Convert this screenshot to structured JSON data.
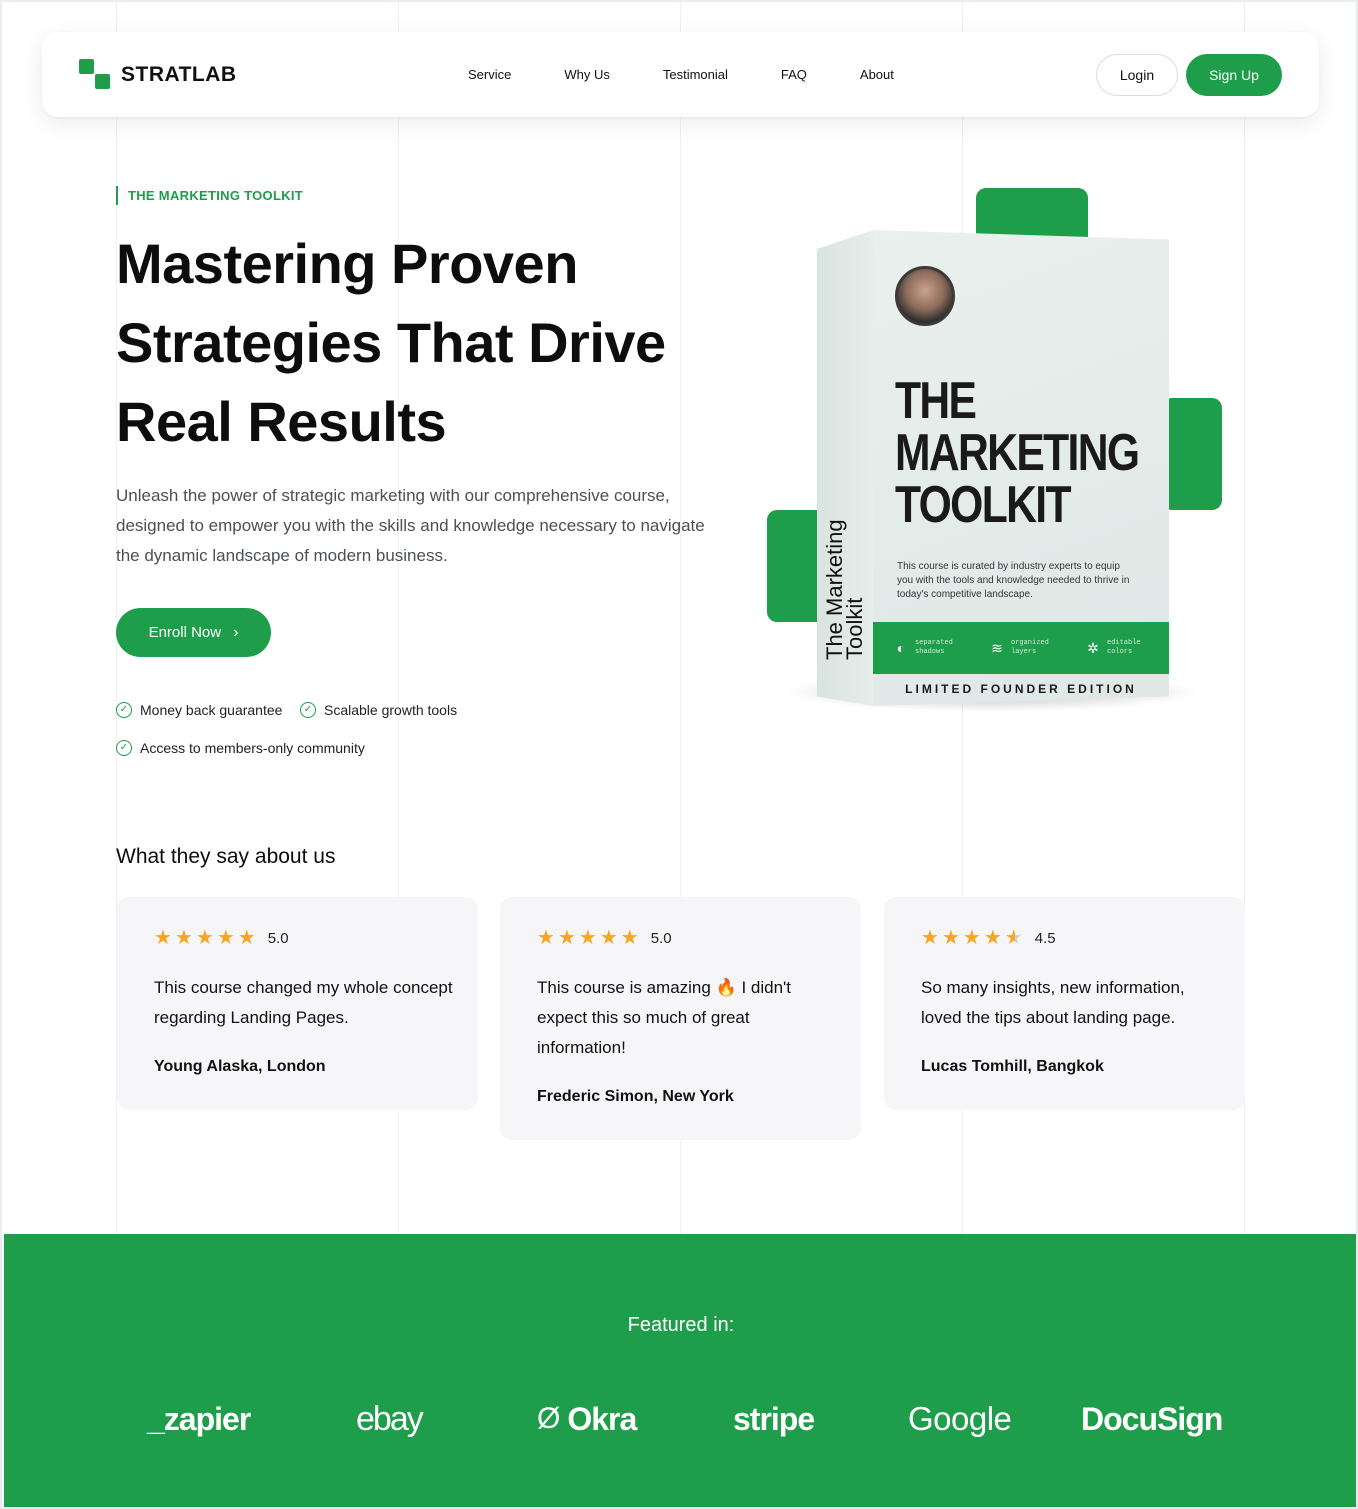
{
  "brand": {
    "name": "STRATLAB",
    "accent": "#1e9e4a"
  },
  "nav": {
    "links": [
      "Service",
      "Why Us",
      "Testimonial",
      "FAQ",
      "About"
    ],
    "login": "Login",
    "signup": "Sign Up"
  },
  "hero": {
    "eyebrow": "THE MARKETING TOOLKIT",
    "title": "Mastering Proven Strategies That Drive Real Results",
    "description": "Unleash the power of strategic marketing with our comprehensive course, designed to empower you with the skills and knowledge necessary to navigate the dynamic landscape of modern business.",
    "cta": "Enroll Now",
    "features": [
      "Money back guarantee",
      "Scalable growth tools",
      "Access to members-only  community"
    ]
  },
  "product": {
    "spine": "The Marketing Toolkit",
    "title": "THE MARKETING TOOLKIT",
    "blurb": "This course is curated by industry experts to equip you with the tools and knowledge needed to thrive in today's competitive landscape.",
    "band": [
      {
        "icon": "leaf-icon",
        "label": "separated shadows"
      },
      {
        "icon": "layers-icon",
        "label": "organized layers"
      },
      {
        "icon": "palette-icon",
        "label": "editable colors"
      }
    ],
    "edition": "LIMITED FOUNDER EDITION"
  },
  "testimonials": {
    "title": "What they say about us",
    "items": [
      {
        "rating": "5.0",
        "stars": 5,
        "quote": "This course changed my whole concept regarding Landing Pages.",
        "author": "Young Alaska, London"
      },
      {
        "rating": "5.0",
        "stars": 5,
        "quote": "This course is amazing 🔥 I didn't expect this so much of great information!",
        "author": "Frederic Simon, New York"
      },
      {
        "rating": "4.5",
        "stars": 4.5,
        "quote": "So many insights, new information, loved the tips about landing page.",
        "author": "Lucas Tomhill, Bangkok"
      }
    ]
  },
  "featured": {
    "title": "Featured in:",
    "logos": [
      "_zapier",
      "ebay",
      "Okra",
      "stripe",
      "Google",
      "DocuSign"
    ]
  }
}
